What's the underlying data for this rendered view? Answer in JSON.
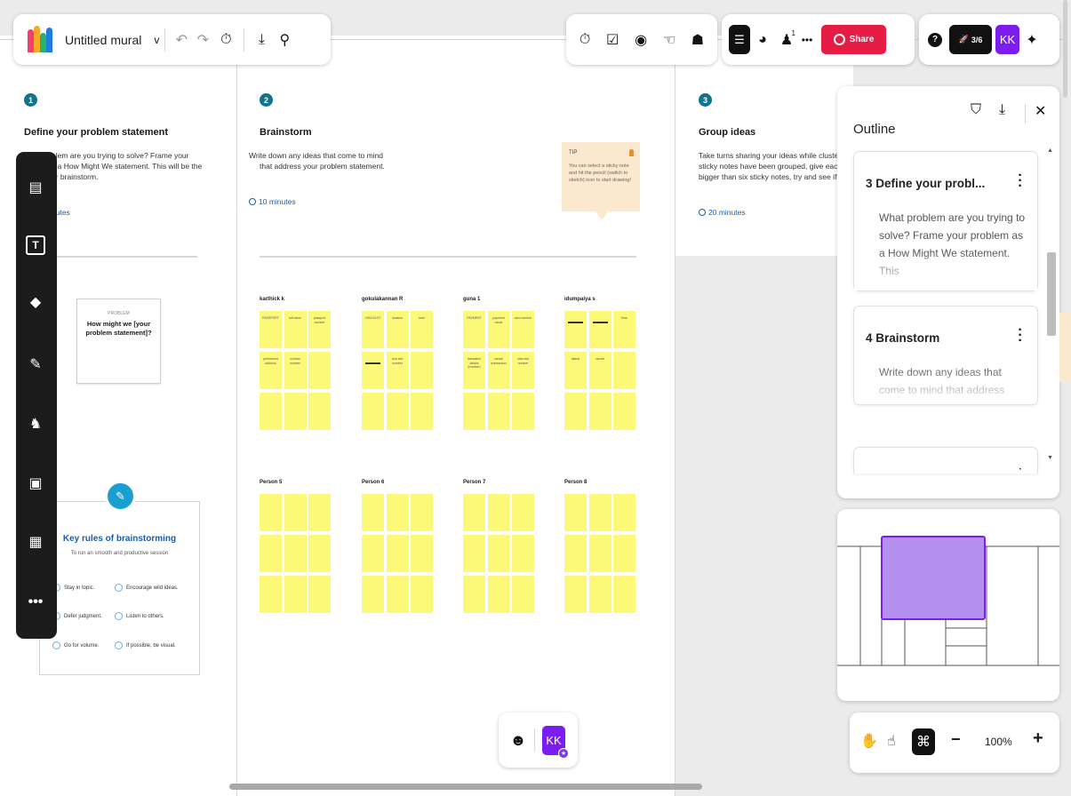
{
  "topbar": {
    "mural_title": "Untitled mural",
    "chevron": "v"
  },
  "right_bar": {
    "notification_count": "1",
    "share_label": "Share",
    "help": "?",
    "timer_progress": "3/6",
    "avatar_initials": "KK"
  },
  "sections": [
    {
      "number": "1",
      "title": "Define your problem statement",
      "desc_line1": "blem are you trying to solve? Frame your",
      "desc_line2": "s a How Might We statement. This will be the",
      "desc_line3": "ur brainstorm.",
      "time": "nutes"
    },
    {
      "number": "2",
      "title": "Brainstorm",
      "desc_line1": "Write down any ideas that come to mind",
      "desc_line2": "that address your problem statement.",
      "time": "10 minutes"
    },
    {
      "number": "3",
      "title": "Group ideas",
      "desc_line1": "Take turns sharing your ideas while clustering",
      "desc_line2": "sticky notes have been grouped, give each c",
      "desc_line3": "bigger than six sticky notes, try and see if you",
      "time": "20 minutes"
    }
  ],
  "tip": {
    "label": "TIP",
    "line1": "You can select a sticky note",
    "line2": "and hit the pencil (switch to",
    "line3": "sketch) icon to start drawing!"
  },
  "problem_card": {
    "label": "PROBLEM",
    "text": "How might we [your problem statement]?"
  },
  "rules": {
    "title": "Key rules of brainstorming",
    "subtitle": "To run an smooth and productive session",
    "items": [
      "Stay in topic.",
      "Encourage wild ideas.",
      "Defer judgment.",
      "Listen to others.",
      "Go for volume.",
      "If possible, be visual."
    ]
  },
  "people": [
    {
      "name": "karthick k",
      "notes": [
        "PASSPORT",
        "full name",
        "passport number",
        "permanent address",
        "contact number"
      ]
    },
    {
      "name": "gokulakannan R",
      "notes": [
        "VISA SLOT",
        "location",
        "time",
        "",
        "visa slot number"
      ]
    },
    {
      "name": "guna 1",
      "notes": [
        "PAYMENT",
        "payment mode",
        "card number",
        "transation details (number)",
        "cancel transaction",
        "visa slot number"
      ]
    },
    {
      "name": "idumpaiya s",
      "notes": [
        "",
        "",
        "time",
        "status",
        "cancel"
      ]
    },
    {
      "name": "Person 5",
      "notes": []
    },
    {
      "name": "Person 6",
      "notes": []
    },
    {
      "name": "Person 7",
      "notes": []
    },
    {
      "name": "Person 8",
      "notes": []
    }
  ],
  "left_toolbar": {
    "icons": [
      "sticky-note-icon",
      "text-icon",
      "shapes-icon",
      "pen-icon",
      "llama-icon",
      "image-icon",
      "templates-icon",
      "more-icon"
    ]
  },
  "outline": {
    "title": "Outline",
    "items": [
      {
        "title": "3   Define your probl...",
        "desc": "What problem are you trying to solve? Frame your problem as a How Might We statement. This"
      },
      {
        "title": "4   Brainstorm",
        "desc": "Write down any ideas that come to mind that address your problem statement."
      }
    ]
  },
  "zoom": {
    "level": "100%",
    "minus": "−",
    "plus": "+"
  },
  "bottom_bar": {
    "avatar_initials": "KK"
  },
  "colors": {
    "sticky": "#fcf979",
    "share": "#e51c44",
    "avatar": "#7c1df0",
    "minimap_view": "#b491f0"
  }
}
